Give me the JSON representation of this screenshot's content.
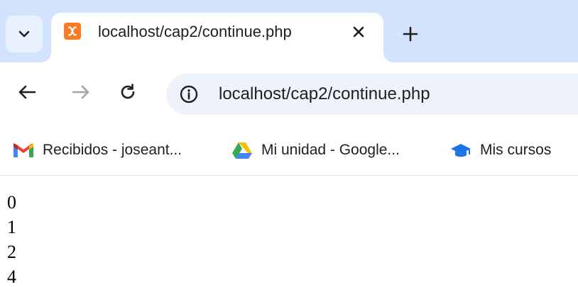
{
  "window": {
    "tabs": [
      {
        "title": "localhost/cap2/continue.php",
        "favicon": "xampp-icon",
        "active": true
      }
    ],
    "tab_search_icon": "chevron-down-icon",
    "close_icon": "close-icon",
    "new_tab_icon": "plus-icon"
  },
  "toolbar": {
    "back_icon": "arrow-left-icon",
    "forward_icon": "arrow-right-icon",
    "reload_icon": "reload-icon",
    "site_info_icon": "site-info-icon",
    "url": "localhost/cap2/continue.php"
  },
  "bookmarks": [
    {
      "label": "Recibidos - joseant...",
      "icon": "gmail-icon"
    },
    {
      "label": "Mi unidad - Google...",
      "icon": "google-drive-icon"
    },
    {
      "label": "Mis cursos",
      "icon": "graduation-cap-icon"
    }
  ],
  "page": {
    "lines": [
      "0",
      "1",
      "2",
      "4"
    ]
  },
  "colors": {
    "tabstrip": "#d3e3fd",
    "omnibox": "#eef3fb",
    "xampp": "#fb7a24",
    "cap_blue": "#1a73e8"
  }
}
